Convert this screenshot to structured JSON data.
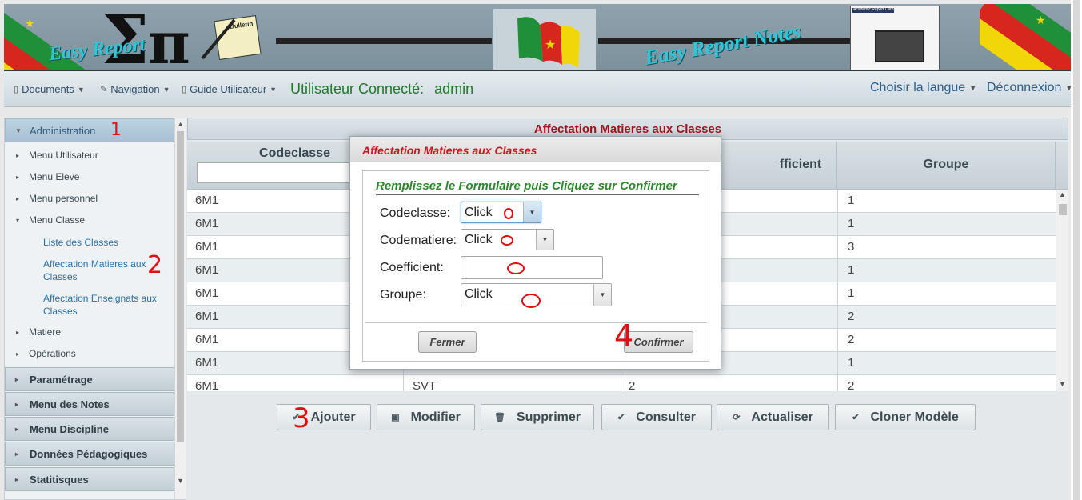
{
  "banner": {
    "title_left": "Easy Report",
    "title_right": "Easy Report Notes",
    "logo_tag": "Bulletin",
    "report_card_title": "Academic Report Card"
  },
  "navbar": {
    "documents": "Documents",
    "navigation": "Navigation",
    "guide": "Guide Utilisateur",
    "user_prefix": "Utilisateur Connecté:",
    "user_name": "admin",
    "language": "Choisir la langue",
    "logout": "Déconnexion"
  },
  "sidebar": {
    "administration": "Administration",
    "menu_utilisateur": "Menu Utilisateur",
    "menu_eleve": "Menu Eleve",
    "menu_personnel": "Menu personnel",
    "menu_classe": "Menu Classe",
    "liste_classes": "Liste des Classes",
    "affectation_matieres": "Affectation Matieres aux Classes",
    "affectation_enseignants": "Affectation Enseignats aux Classes",
    "matiere": "Matiere",
    "operations": "Opérations",
    "parametrage": "Paramétrage",
    "menu_notes": "Menu des Notes",
    "menu_discipline": "Menu Discipline",
    "donnees_pedagogiques": "Données Pédagogiques",
    "statistiques": "Statitisques"
  },
  "annotations": {
    "a1": "1",
    "a2": "2",
    "a3": "3",
    "a4": "4"
  },
  "main": {
    "panel_title": "Affectation Matieres aux Classes",
    "columns": {
      "codeclasse": "Codeclasse",
      "coefficient": "fficient",
      "groupe": "Groupe"
    },
    "rows": [
      {
        "codeclasse": "6M1",
        "matiere": "",
        "coef": "",
        "groupe": "1"
      },
      {
        "codeclasse": "6M1",
        "matiere": "",
        "coef": "",
        "groupe": "1"
      },
      {
        "codeclasse": "6M1",
        "matiere": "",
        "coef": "",
        "groupe": "3"
      },
      {
        "codeclasse": "6M1",
        "matiere": "",
        "coef": "",
        "groupe": "1"
      },
      {
        "codeclasse": "6M1",
        "matiere": "",
        "coef": "",
        "groupe": "1"
      },
      {
        "codeclasse": "6M1",
        "matiere": "",
        "coef": "",
        "groupe": "2"
      },
      {
        "codeclasse": "6M1",
        "matiere": "",
        "coef": "",
        "groupe": "2"
      },
      {
        "codeclasse": "6M1",
        "matiere": "",
        "coef": "",
        "groupe": "1"
      },
      {
        "codeclasse": "6M1",
        "matiere": "SVT",
        "coef": "2",
        "groupe": "2"
      }
    ],
    "toolbar": {
      "ajouter": "Ajouter",
      "modifier": "Modifier",
      "supprimer": "Supprimer",
      "consulter": "Consulter",
      "actualiser": "Actualiser",
      "cloner": "Cloner Modèle"
    }
  },
  "dialog": {
    "title": "Affectation Matieres aux Classes",
    "legend": "Remplissez le Formulaire puis Cliquez sur Confirmer",
    "labels": {
      "codeclasse": "Codeclasse:",
      "codematiere": "Codematiere:",
      "coefficient": "Coefficient:",
      "groupe": "Groupe:"
    },
    "values": {
      "codeclasse": "Click",
      "codematiere": "Click",
      "coefficient": "",
      "groupe": "Click"
    },
    "fermer": "Fermer",
    "confirmer": "Confirmer"
  },
  "colors": {
    "title_red": "#a5121e",
    "legend_green": "#2a8a2a",
    "link_blue": "#2c6fa6",
    "annotation_red": "#e01010"
  }
}
